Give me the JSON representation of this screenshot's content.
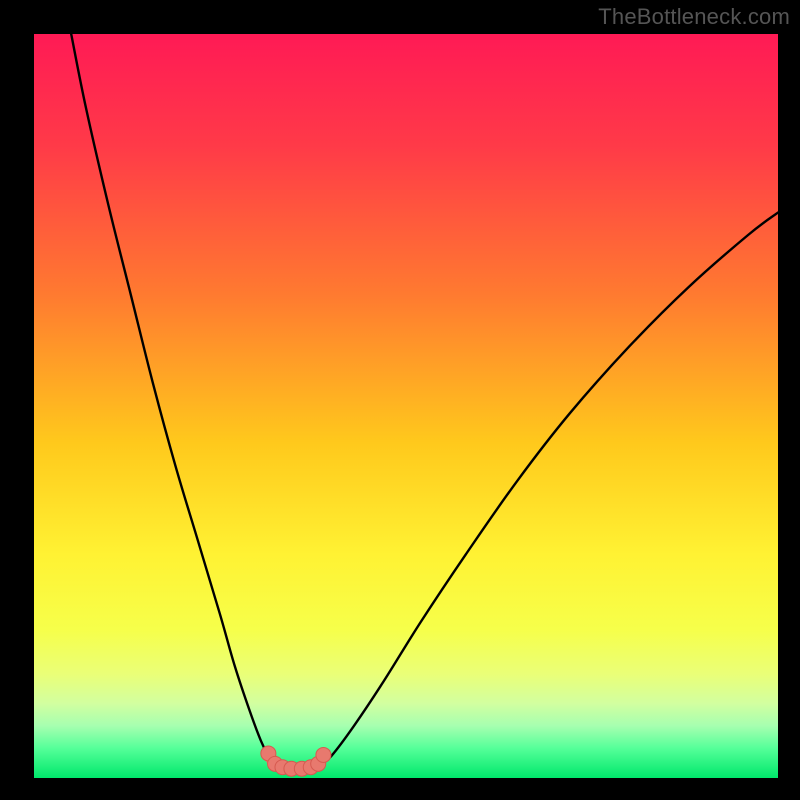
{
  "attribution": "TheBottleneck.com",
  "chart_data": {
    "type": "line",
    "title": "",
    "xlabel": "",
    "ylabel": "",
    "xlim": [
      0,
      100
    ],
    "ylim": [
      0,
      100
    ],
    "series": [
      {
        "name": "left-curve",
        "x": [
          5,
          7,
          10,
          13,
          16,
          19,
          22,
          25,
          27,
          29,
          30.5,
          31.5,
          32.2
        ],
        "y": [
          100,
          90,
          77,
          65,
          53,
          42,
          32,
          22,
          15,
          9,
          5,
          3,
          1.8
        ]
      },
      {
        "name": "right-curve",
        "x": [
          38.5,
          40,
          43,
          47,
          52,
          58,
          65,
          72,
          80,
          88,
          96,
          100
        ],
        "y": [
          1.8,
          3,
          7,
          13,
          21,
          30,
          40,
          49,
          58,
          66,
          73,
          76
        ]
      },
      {
        "name": "flat-bottom",
        "x": [
          32.2,
          34,
          36,
          38.5
        ],
        "y": [
          1.8,
          1.3,
          1.3,
          1.8
        ]
      },
      {
        "name": "marker-points",
        "x": [
          31.5,
          32.4,
          33.4,
          34.6,
          36.0,
          37.2,
          38.2,
          38.9
        ],
        "y": [
          3.3,
          1.9,
          1.45,
          1.25,
          1.25,
          1.45,
          1.9,
          3.1
        ]
      }
    ],
    "gradient_stops": [
      {
        "offset": 0.0,
        "color": "#ff1a55"
      },
      {
        "offset": 0.15,
        "color": "#ff3a48"
      },
      {
        "offset": 0.35,
        "color": "#ff7a30"
      },
      {
        "offset": 0.55,
        "color": "#ffc91c"
      },
      {
        "offset": 0.7,
        "color": "#fff233"
      },
      {
        "offset": 0.8,
        "color": "#f6ff4a"
      },
      {
        "offset": 0.86,
        "color": "#eaff77"
      },
      {
        "offset": 0.9,
        "color": "#d2ffa0"
      },
      {
        "offset": 0.93,
        "color": "#a6ffb0"
      },
      {
        "offset": 0.96,
        "color": "#55ff99"
      },
      {
        "offset": 1.0,
        "color": "#00e86b"
      }
    ],
    "curve_color": "#000000",
    "marker_fill": "#e8796e",
    "marker_stroke": "#d65a50"
  }
}
